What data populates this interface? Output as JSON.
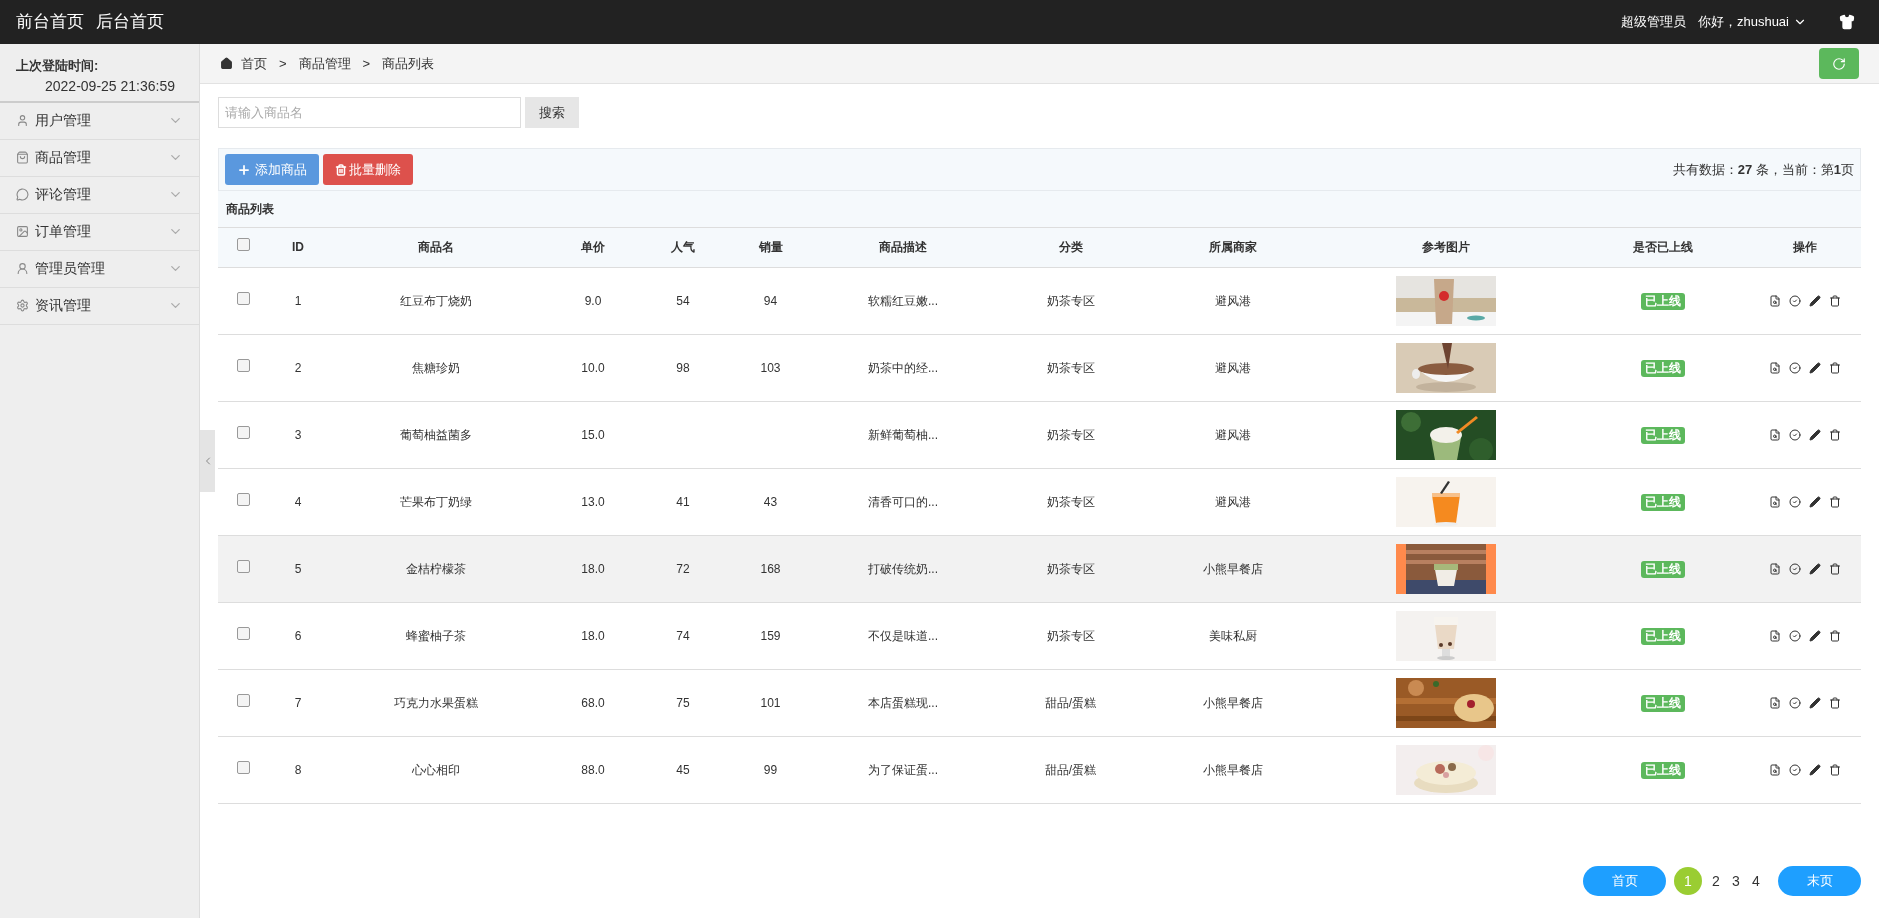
{
  "top_bar": {
    "links": [
      "前台首页",
      "后台首页"
    ],
    "role": "超级管理员",
    "greeting": "你好，zhushuai"
  },
  "sidebar": {
    "login_label": "上次登陆时间:",
    "login_time": "2022-09-25 21:36:59",
    "items": [
      {
        "label": "用户管理",
        "expanded": false
      },
      {
        "label": "商品管理",
        "expanded": false
      },
      {
        "label": "评论管理",
        "expanded": false
      },
      {
        "label": "订单管理",
        "expanded": false
      },
      {
        "label": "管理员管理",
        "expanded": false
      },
      {
        "label": "资讯管理",
        "expanded": false
      }
    ]
  },
  "breadcrumb": [
    "首页",
    "商品管理",
    "商品列表"
  ],
  "breadcrumb_separator": ">",
  "search": {
    "placeholder": "请输入商品名",
    "button": "搜索"
  },
  "toolbar": {
    "add_button": "添加商品",
    "delete_button": "批量删除",
    "summary": "共有数据：**27** 条，当前：第**1**页"
  },
  "table": {
    "caption": "商品列表",
    "all_checked": false,
    "columns": [
      "ID",
      "商品名",
      "单价",
      "人气",
      "销量",
      "商品描述",
      "分类",
      "所属商家",
      "参考图片",
      "是否已上线",
      "操作"
    ],
    "rows": [
      {
        "id": "1",
        "name": "红豆布丁烧奶",
        "price": "9.0",
        "popularity": "54",
        "sales": "94",
        "description": "软糯红豆嫩...",
        "category": "奶茶专区",
        "merchant": "避风港",
        "status": "已上线",
        "checked": false,
        "highlighted": false
      },
      {
        "id": "2",
        "name": "焦糖珍奶",
        "price": "10.0",
        "popularity": "98",
        "sales": "103",
        "description": "奶茶中的经...",
        "category": "奶茶专区",
        "merchant": "避风港",
        "status": "已上线",
        "checked": false,
        "highlighted": false
      },
      {
        "id": "3",
        "name": "葡萄柚益菌多",
        "price": "15.0",
        "description": "新鲜葡萄柚...",
        "category": "奶茶专区",
        "merchant": "避风港",
        "status": "已上线",
        "checked": false,
        "highlighted": false
      },
      {
        "id": "4",
        "name": "芒果布丁奶绿",
        "price": "13.0",
        "popularity": "41",
        "sales": "43",
        "description": "清香可口的...",
        "category": "奶茶专区",
        "merchant": "避风港",
        "status": "已上线",
        "checked": false,
        "highlighted": false
      },
      {
        "id": "5",
        "name": "金桔柠檬茶",
        "price": "18.0",
        "popularity": "72",
        "sales": "168",
        "description": "打破传统奶...",
        "category": "奶茶专区",
        "merchant": "小熊早餐店",
        "status": "已上线",
        "checked": false,
        "highlighted": true
      },
      {
        "id": "6",
        "name": "蜂蜜柚子茶",
        "price": "18.0",
        "popularity": "74",
        "sales": "159",
        "description": "不仅是味道...",
        "category": "奶茶专区",
        "merchant": "美味私厨",
        "status": "已上线",
        "checked": false,
        "highlighted": false
      },
      {
        "id": "7",
        "name": "巧克力水果蛋糕",
        "price": "68.0",
        "popularity": "75",
        "sales": "101",
        "description": "本店蛋糕现...",
        "category": "甜品/蛋糕",
        "merchant": "小熊早餐店",
        "status": "已上线",
        "checked": false,
        "highlighted": false
      },
      {
        "id": "8",
        "name": "心心相印",
        "price": "88.0",
        "popularity": "45",
        "sales": "99",
        "description": "为了保证蛋...",
        "category": "甜品/蛋糕",
        "merchant": "小熊早餐店",
        "status": "已上线",
        "checked": false,
        "highlighted": false
      }
    ]
  },
  "pagination": {
    "first": "首页",
    "last": "末页",
    "pages": [
      {
        "label": "1",
        "selected": true
      },
      {
        "label": "2",
        "selected": false
      },
      {
        "label": "3",
        "selected": false
      },
      {
        "label": "4",
        "selected": false
      }
    ]
  }
}
